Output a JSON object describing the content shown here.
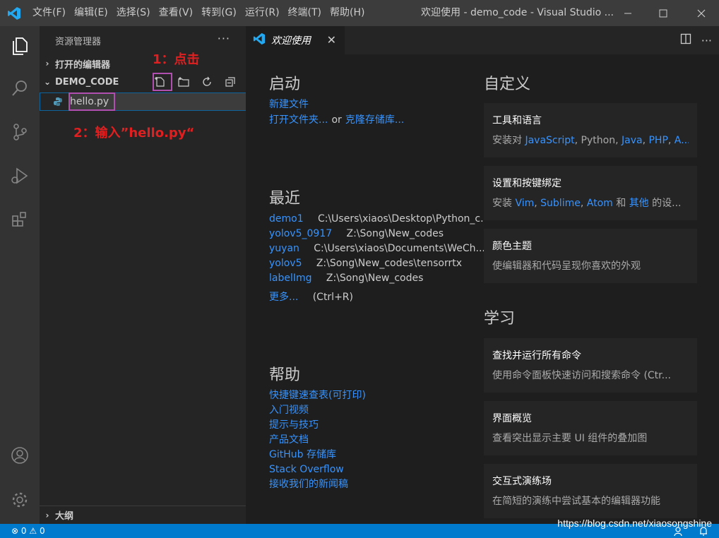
{
  "titlebar": {
    "menu": [
      "文件(F)",
      "编辑(E)",
      "选择(S)",
      "查看(V)",
      "转到(G)",
      "运行(R)",
      "终端(T)",
      "帮助(H)"
    ],
    "window_title": "欢迎使用 - demo_code - Visual Studio ...",
    "controls": [
      "minimize",
      "maximize",
      "close"
    ]
  },
  "activitybar": {
    "icons": [
      "explorer-icon",
      "search-icon",
      "source-control-icon",
      "run-debug-icon",
      "extensions-icon",
      "account-icon",
      "settings-gear-icon"
    ]
  },
  "sidebar": {
    "header": "资源管理器",
    "open_editors": "打开的编辑器",
    "folder": "DEMO_CODE",
    "new_file_value": "hello.py",
    "outline": "大纲",
    "annotation_1": "1：点击",
    "annotation_2": "2：输入”hello.py“"
  },
  "tab": {
    "label": "欢迎使用"
  },
  "welcome": {
    "start": {
      "heading": "启动",
      "new_file": "新建文件",
      "open_folder": "打开文件夹...",
      "or": "or",
      "clone_repo": "克隆存储库..."
    },
    "recent": {
      "heading": "最近",
      "items": [
        {
          "name": "demo1",
          "path": "C:\\Users\\xiaos\\Desktop\\Python_c..."
        },
        {
          "name": "yolov5_0917",
          "path": "Z:\\Song\\New_codes"
        },
        {
          "name": "yuyan",
          "path": "C:\\Users\\xiaos\\Documents\\WeCh..."
        },
        {
          "name": "yolov5",
          "path": "Z:\\Song\\New_codes\\tensorrtx"
        },
        {
          "name": "labelImg",
          "path": "Z:\\Song\\New_codes"
        }
      ],
      "more": "更多...",
      "more_shortcut": "(Ctrl+R)"
    },
    "help": {
      "heading": "帮助",
      "links": [
        "快捷键速查表(可打印)",
        "入门视频",
        "提示与技巧",
        "产品文档",
        "GitHub 存储库",
        "Stack Overflow",
        "接收我们的新闻稿"
      ]
    },
    "customize": {
      "heading": "自定义",
      "cards": [
        {
          "title": "工具和语言",
          "desc_prefix": "安装对 ",
          "desc_links": [
            "JavaScript",
            "Java",
            "PHP",
            "A..."
          ],
          "desc_plain": "Python"
        },
        {
          "title": "设置和按键绑定",
          "desc_prefix": "安装 ",
          "links": [
            "Vim",
            "Sublime",
            "Atom",
            "其他"
          ],
          "and": "和",
          "suffix": "的设..."
        },
        {
          "title": "颜色主题",
          "desc": "使编辑器和代码呈现你喜欢的外观"
        }
      ]
    },
    "learn": {
      "heading": "学习",
      "cards": [
        {
          "title": "查找并运行所有命令",
          "desc": "使用命令面板快速访问和搜索命令 (Ctr..."
        },
        {
          "title": "界面概览",
          "desc": "查看突出显示主要 UI 组件的叠加图"
        },
        {
          "title": "交互式演练场",
          "desc": "在简短的演练中尝试基本的编辑器功能"
        }
      ]
    }
  },
  "statusbar": {
    "errors": "0",
    "warnings": "0"
  },
  "watermark": "https://blog.csdn.net/xiaosongshine"
}
